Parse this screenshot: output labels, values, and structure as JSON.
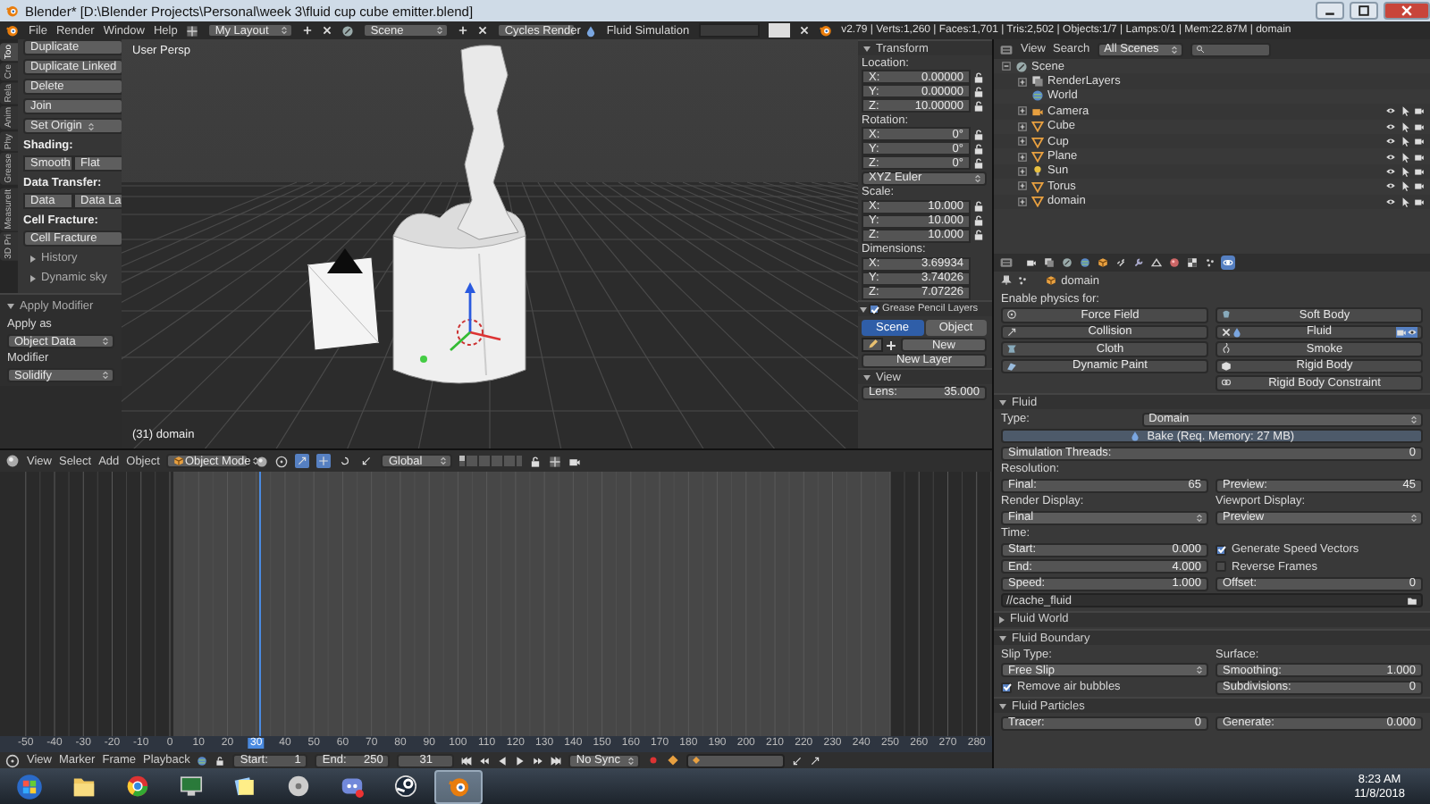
{
  "title_bar": {
    "title": "Blender* [D:\\Blender Projects\\Personal\\week 3\\fluid cup cube emitter.blend]"
  },
  "info_header": {
    "menus": [
      "File",
      "Render",
      "Window",
      "Help"
    ],
    "layout": "My Layout",
    "scene": "Scene",
    "engine": "Cycles Render",
    "label": "Fluid Simulation",
    "stats": "v2.79 | Verts:1,260 | Faces:1,701 | Tris:2,502 | Objects:1/7 | Lamps:0/1 | Mem:22.87M | domain"
  },
  "tool_shelf": {
    "tabs": [
      {
        "label": "Too",
        "selected": true
      },
      {
        "label": "Cre",
        "selected": false
      },
      {
        "label": "Rela",
        "selected": false
      },
      {
        "label": "Anim",
        "selected": false
      },
      {
        "label": "Phy",
        "selected": false
      },
      {
        "label": "Grease",
        "selected": false
      },
      {
        "label": "MeasureIt",
        "selected": false
      },
      {
        "label": "3D Pri",
        "selected": false
      }
    ],
    "items": [
      {
        "kind": "button",
        "label": "Duplicate"
      },
      {
        "kind": "button",
        "label": "Duplicate Linked"
      },
      {
        "kind": "button",
        "label": "Delete"
      },
      {
        "kind": "button",
        "label": "Join"
      },
      {
        "kind": "dropdown",
        "label": "Set Origin"
      },
      {
        "kind": "heading",
        "label": "Shading:"
      },
      {
        "kind": "pair",
        "labels": [
          "Smooth",
          "Flat"
        ]
      },
      {
        "kind": "heading",
        "label": "Data Transfer:"
      },
      {
        "kind": "pair",
        "labels": [
          "Data",
          "Data La"
        ]
      },
      {
        "kind": "heading",
        "label": "Cell Fracture:"
      },
      {
        "kind": "button",
        "label": "Cell Fracture"
      },
      {
        "kind": "subpanel",
        "label": "History",
        "expanded": false
      },
      {
        "kind": "subpanel",
        "label": "Dynamic sky",
        "expanded": false
      }
    ],
    "operator": {
      "title": "Apply Modifier",
      "expanded": true,
      "fields": [
        {
          "label": "Apply as",
          "value": "Object Data"
        },
        {
          "label": "Modifier",
          "value": "Solidify"
        }
      ]
    }
  },
  "viewport": {
    "view_name": "User Persp",
    "object_info": "(31) domain"
  },
  "n_panel": {
    "transform": {
      "title": "Transform",
      "expanded": true,
      "groups": [
        {
          "label": "Location:",
          "lockable": true,
          "fields": [
            {
              "axis": "X:",
              "value": "0.00000"
            },
            {
              "axis": "Y:",
              "value": "0.00000"
            },
            {
              "axis": "Z:",
              "value": "10.00000"
            }
          ]
        },
        {
          "label": "Rotation:",
          "lockable": true,
          "fields": [
            {
              "axis": "X:",
              "value": "0°"
            },
            {
              "axis": "Y:",
              "value": "0°"
            },
            {
              "axis": "Z:",
              "value": "0°"
            }
          ],
          "mode": "XYZ Euler"
        },
        {
          "label": "Scale:",
          "lockable": true,
          "fields": [
            {
              "axis": "X:",
              "value": "10.000"
            },
            {
              "axis": "Y:",
              "value": "10.000"
            },
            {
              "axis": "Z:",
              "value": "10.000"
            }
          ]
        },
        {
          "label": "Dimensions:",
          "lockable": false,
          "fields": [
            {
              "axis": "X:",
              "value": "3.69934"
            },
            {
              "axis": "Y:",
              "value": "3.74026"
            },
            {
              "axis": "Z:",
              "value": "7.07226"
            }
          ]
        }
      ]
    },
    "grease_pencil": {
      "title": "Grease Pencil Layers",
      "expanded": true,
      "checked": true,
      "tabs": [
        {
          "label": "Scene",
          "selected": true
        },
        {
          "label": "Object",
          "selected": false
        }
      ],
      "new_button": "New",
      "new_layer_button": "New Layer"
    },
    "view": {
      "title": "View",
      "expanded": true,
      "lens": {
        "label": "Lens:",
        "value": "35.000"
      }
    }
  },
  "outliner": {
    "menus": [
      "View",
      "Search"
    ],
    "filter": "All Scenes",
    "tree": [
      {
        "label": "Scene",
        "kind": "scene",
        "expanded": true,
        "children": [
          {
            "label": "RenderLayers",
            "kind": "renderlayers",
            "expanded": false
          },
          {
            "label": "World",
            "kind": "world"
          },
          {
            "label": "Camera",
            "kind": "camera",
            "expanded": false
          },
          {
            "label": "Cube",
            "kind": "mesh",
            "expanded": false
          },
          {
            "label": "Cup",
            "kind": "mesh",
            "expanded": false
          },
          {
            "label": "Plane",
            "kind": "mesh",
            "expanded": false
          },
          {
            "label": "Sun",
            "kind": "lamp",
            "expanded": false
          },
          {
            "label": "Torus",
            "kind": "mesh",
            "expanded": false
          },
          {
            "label": "domain",
            "kind": "mesh",
            "expanded": false
          }
        ]
      }
    ]
  },
  "properties": {
    "context_tabs": [
      {
        "kind": "render",
        "selected": false
      },
      {
        "kind": "layers",
        "selected": false
      },
      {
        "kind": "scene",
        "selected": false
      },
      {
        "kind": "world",
        "selected": false
      },
      {
        "kind": "object",
        "selected": false
      },
      {
        "kind": "constraints",
        "selected": false
      },
      {
        "kind": "modifiers",
        "selected": false
      },
      {
        "kind": "data",
        "selected": false
      },
      {
        "kind": "material",
        "selected": false
      },
      {
        "kind": "texture",
        "selected": false
      },
      {
        "kind": "particles",
        "selected": false
      },
      {
        "kind": "physics",
        "selected": true
      }
    ],
    "context": "domain",
    "physics_label": "Enable physics for:",
    "physics_left": [
      {
        "kind": "force_field",
        "label": "Force Field",
        "enabled": false
      },
      {
        "kind": "collision",
        "label": "Collision",
        "enabled": false
      },
      {
        "kind": "cloth",
        "label": "Cloth",
        "enabled": false
      },
      {
        "kind": "dynamic_paint",
        "label": "Dynamic Paint",
        "enabled": false
      }
    ],
    "physics_right": [
      {
        "kind": "soft_body",
        "label": "Soft Body",
        "enabled": false
      },
      {
        "kind": "fluid",
        "label": "Fluid",
        "enabled": true
      },
      {
        "kind": "smoke",
        "label": "Smoke",
        "enabled": false
      },
      {
        "kind": "rigid_body",
        "label": "Rigid Body",
        "enabled": false
      },
      {
        "kind": "rigid_body_constraint",
        "label": "Rigid Body Constraint",
        "enabled": false
      }
    ],
    "fluid": {
      "title": "Fluid",
      "expanded": true,
      "type": {
        "label": "Type:",
        "value": "Domain"
      },
      "bake": "Bake (Req. Memory: 27 MB)",
      "threads": {
        "label": "Simulation Threads:",
        "value": "0"
      },
      "resolution_label": "Resolution:",
      "final": {
        "label": "Final:",
        "value": "65"
      },
      "preview": {
        "label": "Preview:",
        "value": "45"
      },
      "render_display": {
        "label": "Render Display:",
        "value": "Final"
      },
      "viewport_display": {
        "label": "Viewport Display:",
        "value": "Preview"
      },
      "time_label": "Time:",
      "start": {
        "label": "Start:",
        "value": "0.000"
      },
      "end": {
        "label": "End:",
        "value": "4.000"
      },
      "speed": {
        "label": "Speed:",
        "value": "1.000"
      },
      "speed_vectors": {
        "label": "Generate Speed Vectors",
        "checked": true
      },
      "reverse_frames": {
        "label": "Reverse Frames",
        "checked": false
      },
      "offset": {
        "label": "Offset:",
        "value": "0"
      },
      "cache_path": "//cache_fluid"
    },
    "fluid_world": {
      "title": "Fluid World",
      "expanded": false
    },
    "fluid_boundary": {
      "title": "Fluid Boundary",
      "expanded": true,
      "slip_type": {
        "label": "Slip Type:",
        "value": "Free Slip"
      },
      "surface_label": "Surface:",
      "smoothing": {
        "label": "Smoothing:",
        "value": "1.000"
      },
      "subdivisions": {
        "label": "Subdivisions:",
        "value": "0"
      },
      "remove_bubbles": {
        "label": "Remove air bubbles",
        "checked": true
      }
    },
    "fluid_particles": {
      "title": "Fluid Particles",
      "expanded": true,
      "tracer": {
        "label": "Tracer:",
        "value": "0"
      },
      "generate": {
        "label": "Generate:",
        "value": "0.000"
      }
    }
  },
  "view3d_header": {
    "menus": [
      "View",
      "Select",
      "Add",
      "Object"
    ],
    "mode": "Object Mode",
    "orientation": "Global",
    "toggles": [
      {
        "kind": "manipulator",
        "on": true
      },
      {
        "kind": "translate",
        "on": true
      },
      {
        "kind": "rotate",
        "on": false
      },
      {
        "kind": "scale",
        "on": false
      }
    ]
  },
  "timeline": {
    "ruler": [
      "-50",
      "-40",
      "-30",
      "-20",
      "-10",
      "0",
      "10",
      "20",
      "30",
      "40",
      "50",
      "60",
      "70",
      "80",
      "90",
      "100",
      "110",
      "120",
      "130",
      "140",
      "150",
      "160",
      "170",
      "180",
      "190",
      "200",
      "210",
      "220",
      "230",
      "240",
      "250",
      "260",
      "270",
      "280"
    ],
    "menus": [
      "View",
      "Marker",
      "Frame",
      "Playback"
    ],
    "start": {
      "label": "Start:",
      "value": "1"
    },
    "end": {
      "label": "End:",
      "value": "250"
    },
    "current": "31",
    "sync": "No Sync"
  },
  "taskbar": {
    "apps": [
      {
        "kind": "folder",
        "selected": false
      },
      {
        "kind": "browser",
        "selected": false
      },
      {
        "kind": "monitor",
        "selected": false
      },
      {
        "kind": "notes",
        "selected": false
      },
      {
        "kind": "disc",
        "selected": false
      },
      {
        "kind": "chat",
        "selected": false
      },
      {
        "kind": "steam",
        "selected": false
      },
      {
        "kind": "blender",
        "selected": true
      }
    ],
    "time": "8:23 AM",
    "date": "11/8/2018"
  }
}
